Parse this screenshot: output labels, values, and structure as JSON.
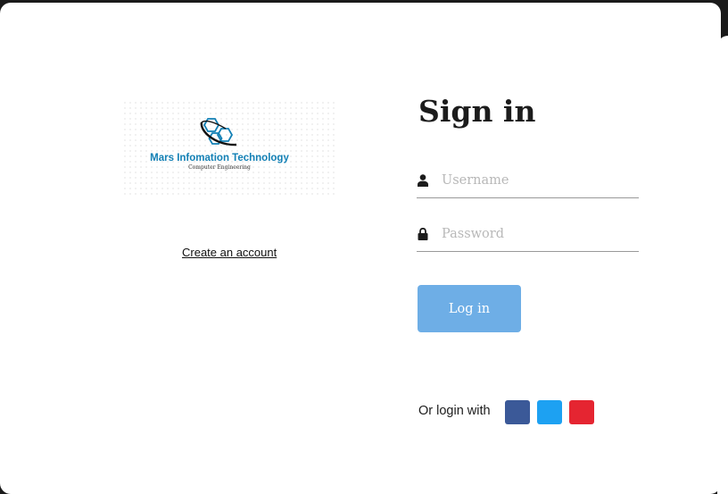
{
  "logo": {
    "title": "Mars Infomation Technology",
    "subtitle": "Computer Engineering",
    "color": "#1380b5"
  },
  "links": {
    "create_account": "Create an account"
  },
  "form": {
    "title": "Sign in",
    "username": {
      "value": "",
      "placeholder": "Username",
      "icon": "user-icon"
    },
    "password": {
      "value": "",
      "placeholder": "Password",
      "icon": "lock-icon"
    },
    "login_button": "Log in",
    "login_button_color": "#6eaee6"
  },
  "social": {
    "label": "Or login with",
    "buttons": [
      {
        "name": "facebook",
        "color": "#3b5998"
      },
      {
        "name": "twitter",
        "color": "#1da1f2"
      },
      {
        "name": "google-plus",
        "color": "#e52531"
      }
    ]
  }
}
